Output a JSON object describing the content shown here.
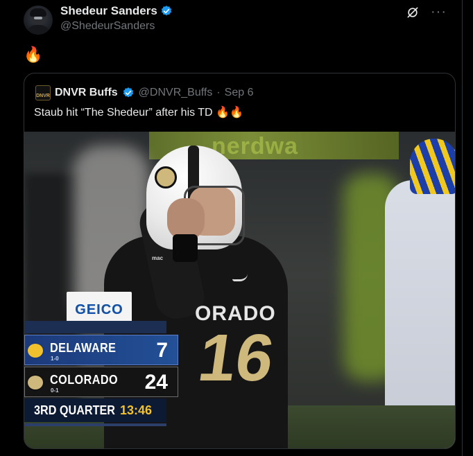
{
  "author": {
    "display_name": "Shedeur Sanders",
    "handle": "@ShedeurSanders"
  },
  "tweet": {
    "text": "🔥"
  },
  "top_icons": {
    "grok": "grok-icon",
    "more": "···"
  },
  "quote": {
    "logo_text": "DNVR",
    "display_name": "DNVR Buffs",
    "handle": "@DNVR_Buffs",
    "separator": "·",
    "date": "Sep 6",
    "text": "Staub hit “The Shedeur” after his TD 🔥🔥"
  },
  "media": {
    "background_banner_text": "nerdwa",
    "sponsor": "GEICO",
    "jersey_text": "ORADO",
    "jersey_number": "16",
    "sleeve_text": "mac",
    "scoreboard": {
      "teams": [
        {
          "name": "DELAWARE",
          "record": "1-0",
          "score": "7"
        },
        {
          "name": "COLORADO",
          "record": "0-1",
          "score": "24"
        }
      ],
      "quarter": "3RD QUARTER",
      "clock": "13:46"
    }
  },
  "colors": {
    "background": "#000000",
    "text": "#e7e9ea",
    "muted": "#71767b",
    "verified": "#1d9bf0",
    "border": "#2f3336"
  }
}
